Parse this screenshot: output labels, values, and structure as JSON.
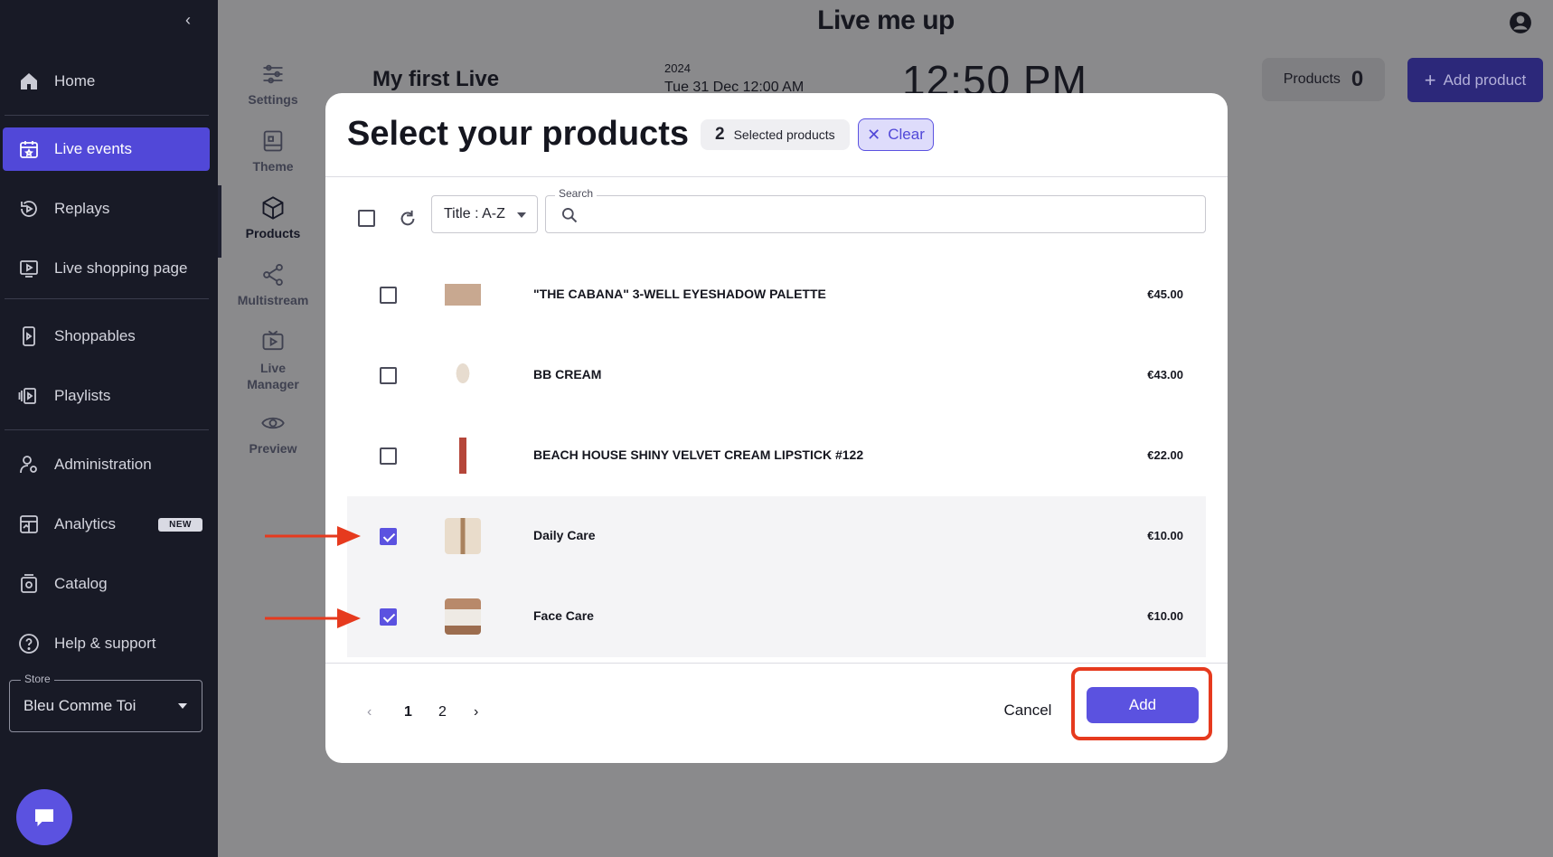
{
  "sidebar": {
    "items": [
      {
        "label": "Home",
        "icon": "home-icon"
      },
      {
        "label": "Live events",
        "icon": "calendar-star-icon",
        "active": true
      },
      {
        "label": "Replays",
        "icon": "replay-icon"
      },
      {
        "label": "Live shopping page",
        "icon": "screen-play-icon"
      },
      {
        "label": "Shoppables",
        "icon": "phone-play-icon"
      },
      {
        "label": "Playlists",
        "icon": "playlist-icon"
      },
      {
        "label": "Administration",
        "icon": "user-settings-icon"
      },
      {
        "label": "Analytics",
        "icon": "analytics-icon",
        "badge": "NEW"
      },
      {
        "label": "Catalog",
        "icon": "catalog-icon"
      },
      {
        "label": "Help & support",
        "icon": "help-icon"
      }
    ],
    "store": {
      "label": "Store",
      "value": "Bleu Comme Toi"
    }
  },
  "rail": {
    "items": [
      {
        "label": "Settings",
        "icon": "sliders-icon"
      },
      {
        "label": "Theme",
        "icon": "theme-icon"
      },
      {
        "label": "Products",
        "icon": "box-icon",
        "active": true
      },
      {
        "label": "Multistream",
        "icon": "share-icon"
      },
      {
        "label": "Live Manager",
        "icon": "tv-play-icon"
      },
      {
        "label": "Preview",
        "icon": "eye-icon"
      }
    ]
  },
  "header": {
    "logo": "Live me up",
    "live_title": "My first Live",
    "live_year": "2024",
    "live_date": "Tue 31 Dec 12:00 AM",
    "live_time": "12:50 PM",
    "products_label": "Products",
    "products_count": "0",
    "add_product_label": "Add product"
  },
  "modal": {
    "title": "Select your products",
    "selected_count": "2",
    "selected_label": "Selected products",
    "clear_label": "Clear",
    "sort_value": "Title : A-Z",
    "search_label": "Search",
    "search_value": "",
    "products": [
      {
        "name": "\"THE CABANA\" 3-WELL EYESHADOW PALETTE",
        "price": "€45.00",
        "checked": false,
        "thumb_color": "#c8a890"
      },
      {
        "name": "BB CREAM",
        "price": "€43.00",
        "checked": false,
        "thumb_color": "#e7dccf"
      },
      {
        "name": "BEACH HOUSE SHINY VELVET CREAM LIPSTICK #122",
        "price": "€22.00",
        "checked": false,
        "thumb_color": "#b5463a"
      },
      {
        "name": "Daily Care",
        "price": "€10.00",
        "checked": true,
        "thumb_color": "#d8c7b0"
      },
      {
        "name": "Face Care",
        "price": "€10.00",
        "checked": true,
        "thumb_color": "#b8896a"
      }
    ],
    "pagination": {
      "pages": [
        "1",
        "2"
      ],
      "current": "1"
    },
    "cancel_label": "Cancel",
    "add_label": "Add"
  },
  "colors": {
    "accent": "#5b52e0",
    "sidebar_bg": "#181a26",
    "highlight": "#e63a1e"
  }
}
